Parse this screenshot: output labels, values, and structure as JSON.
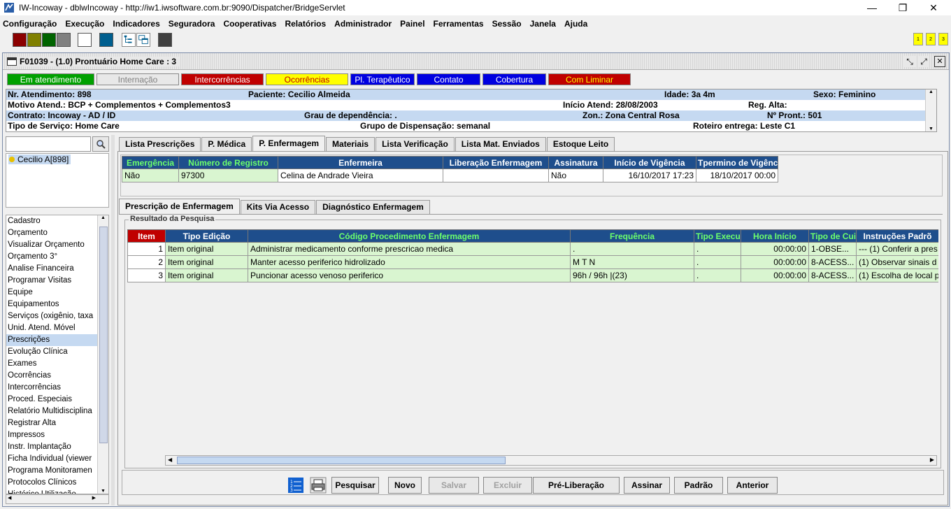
{
  "window": {
    "title": "IW-Incoway - dblwIncoway - http://iw1.iwsoftware.com.br:9090/Dispatcher/BridgeServlet",
    "minimize": "—",
    "maximize": "❐",
    "close": "✕"
  },
  "menu": [
    "Configuração",
    "Execução",
    "Indicadores",
    "Seguradora",
    "Cooperativas",
    "Relatórios",
    "Administrador",
    "Painel",
    "Ferramentas",
    "Sessão",
    "Janela",
    "Ajuda"
  ],
  "toolbar": {
    "colors": [
      "#8b0000",
      "#808000",
      "#006400",
      "#808080",
      "#ffffff",
      "#005f8f",
      "#404040"
    ],
    "num_buttons": [
      "1",
      "2",
      "3"
    ]
  },
  "frame": {
    "title": "F01039 - (1.0) Prontuário Home Care : 3"
  },
  "status_buttons": [
    {
      "label": "Em atendimento",
      "bg": "#00a000",
      "fg": "#ffffff",
      "width": 125
    },
    {
      "label": "Internação",
      "bg": "#e8e8e8",
      "fg": "#808080",
      "width": 118
    },
    {
      "label": "Intercorrências",
      "bg": "#c00000",
      "fg": "#ffffff",
      "width": 118
    },
    {
      "label": "Ocorrências",
      "bg": "#ffff00",
      "fg": "#c00000",
      "width": 118
    },
    {
      "label": "Pl. Terapêutico",
      "bg": "#0000e0",
      "fg": "#ffffff",
      "width": 92
    },
    {
      "label": "Contato",
      "bg": "#0000e0",
      "fg": "#ffffff",
      "width": 91
    },
    {
      "label": "Cobertura",
      "bg": "#0000e0",
      "fg": "#ffffff",
      "width": 91
    },
    {
      "label": "Com Liminar",
      "bg": "#c00000",
      "fg": "#ffff00",
      "width": 118
    }
  ],
  "info": {
    "nr_atendimento_label": "Nr. Atendimento:",
    "nr_atendimento": "898",
    "paciente_label": "Paciente:",
    "paciente": "Cecilio Almeida",
    "idade_label": "Idade:",
    "idade": "3a 4m",
    "sexo_label": "Sexo:",
    "sexo": "Feminino",
    "motivo_label": "Motivo Atend.:",
    "motivo": "BCP + Complementos + Complementos3",
    "inicio_label": "Início Atend:",
    "inicio": "28/08/2003",
    "reg_alta_label": "Reg. Alta:",
    "reg_alta": "",
    "contrato_label": "Contrato:",
    "contrato": "Incoway - AD / ID",
    "grau_label": "Grau de dependência:",
    "grau": ".",
    "zona_label": "Zon.:",
    "zona": "Zona Central Rosa",
    "pront_label": "Nº Pront.:",
    "pront": "501",
    "tipo_servico_label": "Tipo de Serviço:",
    "tipo_servico": "Home Care",
    "grupo_label": "Grupo de Dispensação:",
    "grupo": "semanal",
    "roteiro_label": "Roteiro entrega:",
    "roteiro": "Leste C1"
  },
  "left": {
    "search_placeholder": "",
    "patient": "Cecilio A[898]",
    "nav_items": [
      "Cadastro",
      "Orçamento",
      "Visualizar Orçamento",
      "Orçamento 3°",
      "Analise Financeira",
      "Programar Visitas",
      "Equipe",
      "Equipamentos",
      "Serviços (oxigênio, taxa",
      "Unid. Atend. Móvel",
      "Prescrições",
      "Evolução Clínica",
      "Exames",
      "Ocorrências",
      "Intercorrências",
      "Proced. Especiais",
      "Relatório Multidisciplina",
      "Registrar Alta",
      "Impressos",
      "Instr. Implantação",
      "Ficha Individual (viewer",
      "Programa Monitoramen",
      "Protocolos Clínicos",
      "Histórico Utilização"
    ],
    "selected_index": 10
  },
  "tabs": [
    "Lista Prescrições",
    "P. Médica",
    "P. Enfermagem",
    "Materiais",
    "Lista Verificação",
    "Lista Mat. Enviados",
    "Estoque Leito"
  ],
  "active_tab": 2,
  "top_table": {
    "headers": [
      "Emergência",
      "Número de Registro",
      "Enfermeira",
      "Liberação Enfermagem",
      "Assinatura",
      "Início de Vigência",
      "Tpermino de Vigênci"
    ],
    "row": [
      "Não",
      "97300",
      "Celina de Andrade Vieira",
      "",
      "Não",
      "16/10/2017 17:23",
      "18/10/2017 00:00"
    ]
  },
  "subtabs": [
    "Prescrição de Enfermagem",
    "Kits Via Acesso",
    "Diagnóstico Enfermagem"
  ],
  "active_subtab": 0,
  "group_label": "Resultado da Pesquisa",
  "grid": {
    "headers": [
      "Item",
      "Tipo Edição",
      "Código Procedimento Enfermagem",
      "Frequência",
      "Tipo Execu",
      "Hora Início",
      "Tipo de Cui",
      "Instruções Padrõ"
    ],
    "rows": [
      [
        "1",
        "Item original",
        "Administrar medicamento conforme prescricao medica",
        ".",
        ".",
        "00:00:00",
        "1-OBSE...",
        "--- (1) Conferir a pres"
      ],
      [
        "2",
        "Item original",
        "Manter acesso periferico hidrolizado",
        "M T N",
        ".",
        "00:00:00",
        "8-ACESS...",
        "(1) Observar sinais d"
      ],
      [
        "3",
        "Item original",
        "Puncionar acesso venoso periferico",
        "96h / 96h |(23)",
        ".",
        "00:00:00",
        "8-ACESS...",
        "(1) Escolha de local p"
      ]
    ]
  },
  "buttons": [
    {
      "label": "Pesquisar",
      "enabled": true
    },
    {
      "label": "Novo",
      "enabled": true
    },
    {
      "label": "Salvar",
      "enabled": false
    },
    {
      "label": "Excluir",
      "enabled": false
    },
    {
      "label": "Pré-Liberação",
      "enabled": true
    },
    {
      "label": "Assinar",
      "enabled": true
    },
    {
      "label": "Padrão",
      "enabled": true
    },
    {
      "label": "Anterior",
      "enabled": true
    }
  ]
}
